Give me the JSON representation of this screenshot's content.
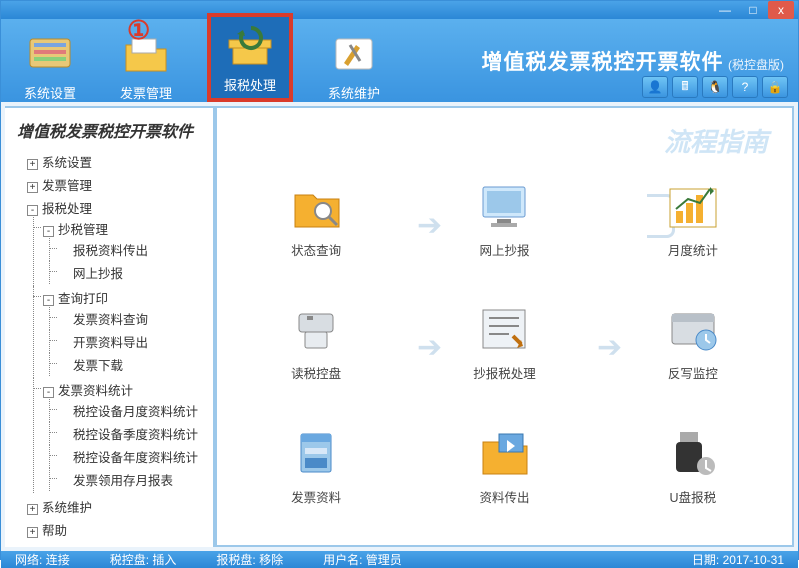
{
  "titlebar": {
    "min": "—",
    "max": "□",
    "close": "x"
  },
  "annotation": "①",
  "toolbar": [
    {
      "name": "system-settings",
      "label": "系统设置"
    },
    {
      "name": "invoice-mgmt",
      "label": "发票管理"
    },
    {
      "name": "tax-process",
      "label": "报税处理",
      "selected": true
    },
    {
      "name": "system-maint",
      "label": "系统维护"
    }
  ],
  "brand": {
    "title": "增值税发票税控开票软件",
    "sub": "(税控盘版)"
  },
  "ribbon": [
    "user",
    "calc",
    "QQ",
    "help",
    "lock"
  ],
  "sidebar": {
    "title": "增值税发票税控开票软件",
    "tree": [
      {
        "label": "系统设置",
        "tg": "+"
      },
      {
        "label": "发票管理",
        "tg": "+"
      },
      {
        "label": "报税处理",
        "tg": "-",
        "children": [
          {
            "label": "抄税管理",
            "tg": "-",
            "children": [
              {
                "label": "报税资料传出"
              },
              {
                "label": "网上抄报"
              }
            ]
          },
          {
            "label": "查询打印",
            "tg": "-",
            "children": [
              {
                "label": "发票资料查询"
              },
              {
                "label": "开票资料导出"
              },
              {
                "label": "发票下载"
              }
            ]
          },
          {
            "label": "发票资料统计",
            "tg": "-",
            "children": [
              {
                "label": "税控设备月度资料统计"
              },
              {
                "label": "税控设备季度资料统计"
              },
              {
                "label": "税控设备年度资料统计"
              },
              {
                "label": "发票领用存月报表"
              }
            ]
          }
        ]
      },
      {
        "label": "系统维护",
        "tg": "+"
      },
      {
        "label": "帮助",
        "tg": "+"
      }
    ]
  },
  "main": {
    "flow_title": "流程指南",
    "cells": [
      {
        "name": "status-query",
        "label": "状态查询"
      },
      {
        "name": "online-report",
        "label": "网上抄报"
      },
      {
        "name": "monthly-stats",
        "label": "月度统计"
      },
      {
        "name": "read-disk",
        "label": "读税控盘"
      },
      {
        "name": "report-process",
        "label": "抄报税处理"
      },
      {
        "name": "writeback-monitor",
        "label": "反写监控"
      },
      {
        "name": "invoice-data",
        "label": "发票资料"
      },
      {
        "name": "data-export",
        "label": "资料传出"
      },
      {
        "name": "udisk-tax",
        "label": "U盘报税"
      }
    ]
  },
  "status": {
    "network_k": "网络:",
    "network_v": "连接",
    "disk_k": "税控盘:",
    "disk_v": "插入",
    "rdisk_k": "报税盘:",
    "rdisk_v": "移除",
    "user_k": "用户名:",
    "user_v": "管理员",
    "date_k": "日期:",
    "date_v": "2017-10-31"
  }
}
